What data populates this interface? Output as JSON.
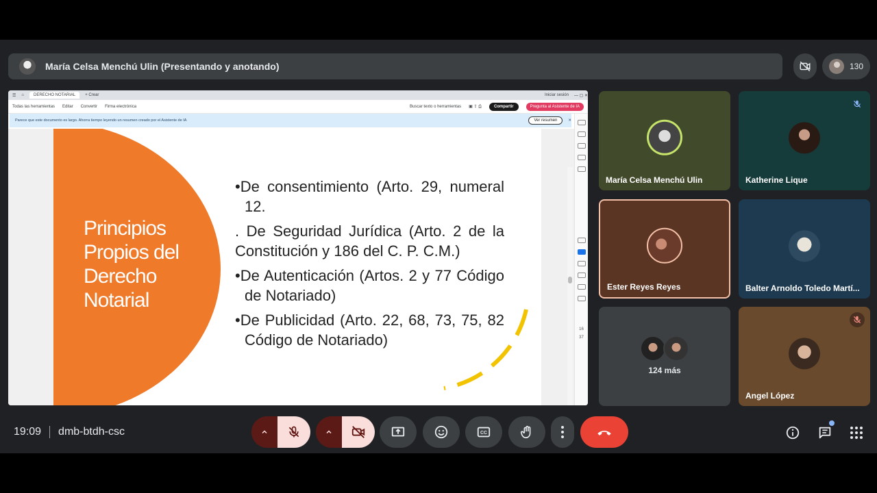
{
  "header": {
    "presenter_label": "María Celsa Menchú Ulin (Presentando y anotando)",
    "participant_count": "130"
  },
  "shared_screen": {
    "browser": {
      "tab_label": "DERECHO NOTARIAL",
      "new_tab_label": "+ Crear",
      "signin_label": "Iniciar sesión"
    },
    "toolbar": {
      "all_tools": "Todas las herramientas",
      "edit": "Editar",
      "convert": "Convertir",
      "esign": "Firma electrónica",
      "search": "Buscar texto o herramientas",
      "share": "Compartir",
      "ai_assistant": "Pregunta al Asistente de IA"
    },
    "notice": {
      "text": "Parece que este documento es largo. Ahorra tiempo leyendo un resumen creado por el Asistente de IA",
      "button": "Ver resumen"
    },
    "page_numbers": [
      "16",
      "37"
    ],
    "slide": {
      "title": "Principios Propios del Derecho Notarial",
      "bullets": [
        {
          "marker": "•",
          "text": "De consentimiento (Arto. 29, numeral 12."
        },
        {
          "marker": "",
          "text": ". De Seguridad Jurídica (Arto. 2 de la Constitución y 186 del C. P. C.M.)"
        },
        {
          "marker": "•",
          "text": "De Autenticación (Artos. 2 y 77 Código de Notariado)"
        },
        {
          "marker": "•",
          "text": "De Publicidad (Arto. 22, 68, 73, 75, 82 Código de Notariado)"
        }
      ]
    }
  },
  "participants": [
    {
      "name": "María Celsa Menchú Ulin",
      "muted": false
    },
    {
      "name": "Katherine Lique",
      "muted": true
    },
    {
      "name": "Ester Reyes Reyes",
      "muted": false
    },
    {
      "name": "Balter Arnoldo Toledo Martí...",
      "muted": false
    },
    {
      "name": "124 más",
      "muted": false
    },
    {
      "name": "Angel López",
      "muted": true
    }
  ],
  "footer": {
    "time": "19:09",
    "meeting_code": "dmb-btdh-csc"
  },
  "colors": {
    "accent_orange": "#ee7a2a",
    "end_call_red": "#ea4335",
    "arc_yellow": "#f2c300"
  },
  "icons": [
    "mic-off-icon",
    "camera-off-icon",
    "present-icon",
    "emoji-icon",
    "captions-icon",
    "raise-hand-icon",
    "more-icon",
    "end-call-icon",
    "info-icon",
    "chat-icon",
    "activities-icon"
  ]
}
